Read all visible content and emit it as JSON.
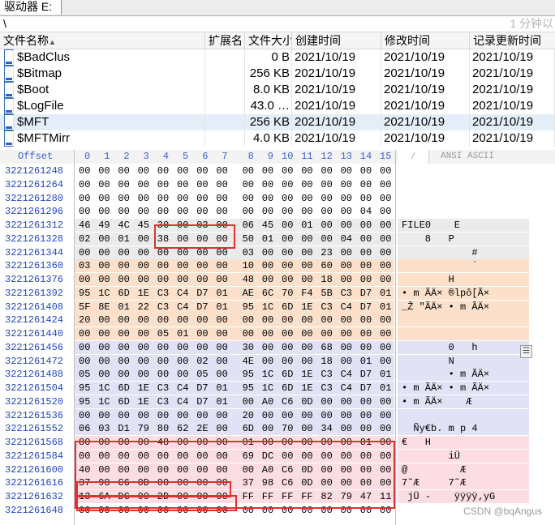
{
  "tab": {
    "label": "驱动器 E:"
  },
  "path": {
    "text": "\\",
    "ago": "1 分钟以"
  },
  "columns": [
    "文件名称",
    "扩展名",
    "文件大小",
    "创建时间",
    "修改时间",
    "记录更新时间"
  ],
  "files": [
    {
      "name": "$BadClus",
      "ext": "",
      "size": "0 B",
      "created": "2021/10/19",
      "modified": "2021/10/19",
      "updated": "2021/10/19"
    },
    {
      "name": "$Bitmap",
      "ext": "",
      "size": "256 KB",
      "created": "2021/10/19",
      "modified": "2021/10/19",
      "updated": "2021/10/19"
    },
    {
      "name": "$Boot",
      "ext": "",
      "size": "8.0 KB",
      "created": "2021/10/19",
      "modified": "2021/10/19",
      "updated": "2021/10/19"
    },
    {
      "name": "$LogFile",
      "ext": "",
      "size": "43.0 …",
      "created": "2021/10/19",
      "modified": "2021/10/19",
      "updated": "2021/10/19"
    },
    {
      "name": "$MFT",
      "ext": "",
      "size": "256 KB",
      "created": "2021/10/19",
      "modified": "2021/10/19",
      "updated": "2021/10/19",
      "selected": true
    },
    {
      "name": "$MFTMirr",
      "ext": "",
      "size": "4.0 KB",
      "created": "2021/10/19",
      "modified": "2021/10/19",
      "updated": "2021/10/19"
    }
  ],
  "hex": {
    "offset_label": "Offset",
    "col_labels": [
      "0",
      "1",
      "2",
      "3",
      "4",
      "5",
      "6",
      "7",
      "8",
      "9",
      "10",
      "11",
      "12",
      "13",
      "14",
      "15"
    ],
    "text_header": "ANSI ASCII",
    "colors": {
      "gray": "#ebebeb",
      "peach": "#fbe1cc",
      "lavender": "#e2e2f6",
      "pink": "#fbdde3"
    },
    "rows": [
      {
        "offset": "3221261248",
        "bytes": [
          "00",
          "00",
          "00",
          "00",
          "00",
          "00",
          "00",
          "00",
          "00",
          "00",
          "00",
          "00",
          "00",
          "00",
          "00",
          "00"
        ],
        "text": "",
        "bg": ""
      },
      {
        "offset": "3221261264",
        "bytes": [
          "00",
          "00",
          "00",
          "00",
          "00",
          "00",
          "00",
          "00",
          "00",
          "00",
          "00",
          "00",
          "00",
          "00",
          "00",
          "00"
        ],
        "text": "",
        "bg": ""
      },
      {
        "offset": "3221261280",
        "bytes": [
          "00",
          "00",
          "00",
          "00",
          "00",
          "00",
          "00",
          "00",
          "00",
          "00",
          "00",
          "00",
          "00",
          "00",
          "00",
          "00"
        ],
        "text": "",
        "bg": ""
      },
      {
        "offset": "3221261296",
        "bytes": [
          "00",
          "00",
          "00",
          "00",
          "00",
          "00",
          "00",
          "00",
          "00",
          "00",
          "00",
          "00",
          "00",
          "00",
          "04",
          "00"
        ],
        "text": "",
        "bg": ""
      },
      {
        "offset": "3221261312",
        "bytes": [
          "46",
          "49",
          "4C",
          "45",
          "30",
          "00",
          "03",
          "00",
          "06",
          "45",
          "00",
          "01",
          "00",
          "00",
          "00",
          "00"
        ],
        "text": "FILE0    E",
        "bg": "gray"
      },
      {
        "offset": "3221261328",
        "bytes": [
          "02",
          "00",
          "01",
          "00",
          "38",
          "00",
          "00",
          "00",
          "50",
          "01",
          "00",
          "00",
          "00",
          "04",
          "00",
          "00"
        ],
        "text": "    8   P",
        "bg": "gray"
      },
      {
        "offset": "3221261344",
        "bytes": [
          "00",
          "00",
          "00",
          "00",
          "00",
          "00",
          "00",
          "00",
          "03",
          "00",
          "00",
          "00",
          "23",
          "00",
          "00",
          "00"
        ],
        "text": "            #",
        "bg": "gray"
      },
      {
        "offset": "3221261360",
        "bytes": [
          "03",
          "00",
          "00",
          "00",
          "00",
          "00",
          "00",
          "00",
          "10",
          "00",
          "00",
          "00",
          "60",
          "00",
          "00",
          "00"
        ],
        "text": "            `",
        "bg": "peach"
      },
      {
        "offset": "3221261376",
        "bytes": [
          "00",
          "00",
          "00",
          "00",
          "00",
          "00",
          "00",
          "00",
          "48",
          "00",
          "00",
          "00",
          "18",
          "00",
          "00",
          "00"
        ],
        "text": "        H",
        "bg": "peach"
      },
      {
        "offset": "3221261392",
        "bytes": [
          "95",
          "1C",
          "6D",
          "1E",
          "C3",
          "C4",
          "D7",
          "01",
          "AE",
          "6C",
          "70",
          "F4",
          "5B",
          "C3",
          "D7",
          "01"
        ],
        "text": "• m ÃÄ× ®lpô[Ã×",
        "bg": "peach"
      },
      {
        "offset": "3221261408",
        "bytes": [
          "5F",
          "8E",
          "01",
          "22",
          "C3",
          "C4",
          "D7",
          "01",
          "95",
          "1C",
          "6D",
          "1E",
          "C3",
          "C4",
          "D7",
          "01"
        ],
        "text": "_Ž \"ÃÄ× • m ÃÄ×",
        "bg": "peach"
      },
      {
        "offset": "3221261424",
        "bytes": [
          "20",
          "00",
          "00",
          "00",
          "00",
          "00",
          "00",
          "00",
          "00",
          "00",
          "00",
          "00",
          "00",
          "00",
          "00",
          "00"
        ],
        "text": "",
        "bg": "peach"
      },
      {
        "offset": "3221261440",
        "bytes": [
          "00",
          "00",
          "00",
          "00",
          "05",
          "01",
          "00",
          "00",
          "00",
          "00",
          "00",
          "00",
          "00",
          "00",
          "00",
          "00"
        ],
        "text": "",
        "bg": "peach"
      },
      {
        "offset": "3221261456",
        "bytes": [
          "00",
          "00",
          "00",
          "00",
          "00",
          "00",
          "00",
          "00",
          "30",
          "00",
          "00",
          "00",
          "68",
          "00",
          "00",
          "00"
        ],
        "text": "        0   h",
        "bg": "lavender"
      },
      {
        "offset": "3221261472",
        "bytes": [
          "00",
          "00",
          "00",
          "00",
          "00",
          "00",
          "02",
          "00",
          "4E",
          "00",
          "00",
          "00",
          "18",
          "00",
          "01",
          "00"
        ],
        "text": "        N",
        "bg": "lavender"
      },
      {
        "offset": "3221261488",
        "bytes": [
          "05",
          "00",
          "00",
          "00",
          "00",
          "00",
          "05",
          "00",
          "95",
          "1C",
          "6D",
          "1E",
          "C3",
          "C4",
          "D7",
          "01"
        ],
        "text": "        • m ÃÄ×",
        "bg": "lavender"
      },
      {
        "offset": "3221261504",
        "bytes": [
          "95",
          "1C",
          "6D",
          "1E",
          "C3",
          "C4",
          "D7",
          "01",
          "95",
          "1C",
          "6D",
          "1E",
          "C3",
          "C4",
          "D7",
          "01"
        ],
        "text": "• m ÃÄ× • m ÃÄ×",
        "bg": "lavender"
      },
      {
        "offset": "3221261520",
        "bytes": [
          "95",
          "1C",
          "6D",
          "1E",
          "C3",
          "C4",
          "D7",
          "01",
          "00",
          "A0",
          "C6",
          "0D",
          "00",
          "00",
          "00",
          "00"
        ],
        "text": "• m ÃÄ×    Æ",
        "bg": "lavender"
      },
      {
        "offset": "3221261536",
        "bytes": [
          "00",
          "00",
          "00",
          "00",
          "00",
          "00",
          "00",
          "00",
          "20",
          "00",
          "00",
          "00",
          "00",
          "00",
          "00",
          "00"
        ],
        "text": "",
        "bg": "lavender"
      },
      {
        "offset": "3221261552",
        "bytes": [
          "06",
          "03",
          "D1",
          "79",
          "80",
          "62",
          "2E",
          "00",
          "6D",
          "00",
          "70",
          "00",
          "34",
          "00",
          "00",
          "00"
        ],
        "text": "  Ñy€b. m p 4",
        "bg": "lavender"
      },
      {
        "offset": "3221261568",
        "bytes": [
          "80",
          "00",
          "00",
          "00",
          "48",
          "00",
          "00",
          "00",
          "01",
          "00",
          "00",
          "00",
          "00",
          "00",
          "01",
          "00"
        ],
        "text": "€   H",
        "bg": "pink"
      },
      {
        "offset": "3221261584",
        "bytes": [
          "00",
          "00",
          "00",
          "00",
          "00",
          "00",
          "00",
          "00",
          "69",
          "DC",
          "00",
          "00",
          "00",
          "00",
          "00",
          "00"
        ],
        "text": "        iÜ",
        "bg": "pink"
      },
      {
        "offset": "3221261600",
        "bytes": [
          "40",
          "00",
          "00",
          "00",
          "00",
          "00",
          "00",
          "00",
          "00",
          "A0",
          "C6",
          "0D",
          "00",
          "00",
          "00",
          "00"
        ],
        "text": "@         Æ",
        "bg": "pink"
      },
      {
        "offset": "3221261616",
        "bytes": [
          "37",
          "98",
          "C6",
          "0D",
          "00",
          "00",
          "00",
          "00",
          "37",
          "98",
          "C6",
          "0D",
          "00",
          "00",
          "00",
          "00"
        ],
        "text": "7˜Æ     7˜Æ",
        "bg": "pink"
      },
      {
        "offset": "3221261632",
        "bytes": [
          "13",
          "6A",
          "DC",
          "00",
          "2D",
          "00",
          "00",
          "00",
          "FF",
          "FF",
          "FF",
          "FF",
          "82",
          "79",
          "47",
          "11"
        ],
        "text": " jÜ -    ÿÿÿÿ‚yG",
        "bg": "pink"
      },
      {
        "offset": "3221261648",
        "bytes": [
          "00",
          "00",
          "00",
          "00",
          "00",
          "00",
          "00",
          "00",
          "00",
          "00",
          "00",
          "00",
          "00",
          "00",
          "00",
          "00"
        ],
        "text": "",
        "bg": ""
      }
    ]
  },
  "watermark": "CSDN @bqAngus"
}
